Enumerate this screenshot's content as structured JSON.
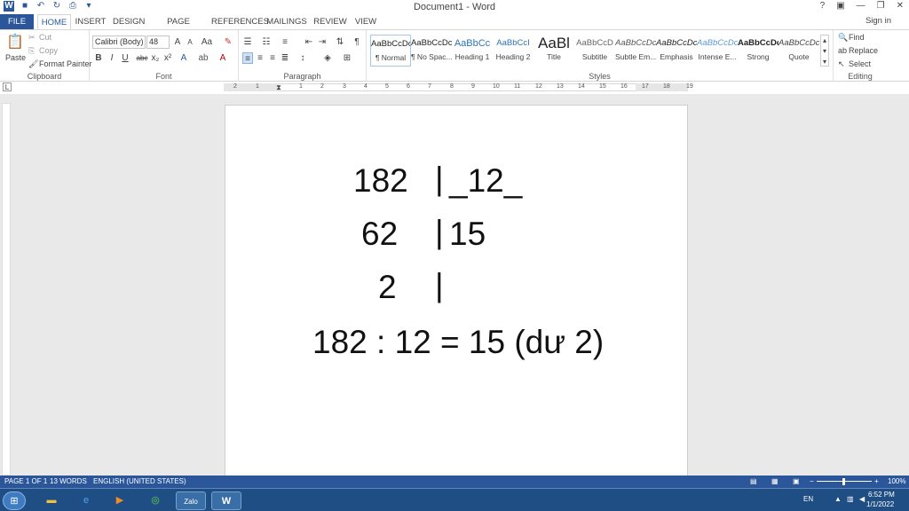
{
  "window": {
    "title": "Document1 - Word",
    "help": "?",
    "signin": "Sign in"
  },
  "tabs": [
    "FILE",
    "HOME",
    "INSERT",
    "DESIGN",
    "PAGE LAYOUT",
    "REFERENCES",
    "MAILINGS",
    "REVIEW",
    "VIEW"
  ],
  "clipboard": {
    "paste": "Paste",
    "cut": "Cut",
    "copy": "Copy",
    "format_painter": "Format Painter",
    "label": "Clipboard"
  },
  "font": {
    "name": "Calibri (Body)",
    "size": "48",
    "label": "Font"
  },
  "paragraph": {
    "label": "Paragraph"
  },
  "styles": {
    "label": "Styles",
    "items": [
      {
        "preview": "AaBbCcDc",
        "name": "¶ Normal"
      },
      {
        "preview": "AaBbCcDc",
        "name": "¶ No Spac..."
      },
      {
        "preview": "AaBbCc",
        "name": "Heading 1"
      },
      {
        "preview": "AaBbCcI",
        "name": "Heading 2"
      },
      {
        "preview": "AaBl",
        "name": "Title"
      },
      {
        "preview": "AaBbCcD",
        "name": "Subtitle"
      },
      {
        "preview": "AaBbCcDc",
        "name": "Subtle Em..."
      },
      {
        "preview": "AaBbCcDc",
        "name": "Emphasis"
      },
      {
        "preview": "AaBbCcDc",
        "name": "Intense E..."
      },
      {
        "preview": "AaBbCcDc",
        "name": "Strong"
      },
      {
        "preview": "AaBbCcDc",
        "name": "Quote"
      }
    ]
  },
  "editing": {
    "find": "Find",
    "replace": "Replace",
    "select": "Select",
    "label": "Editing"
  },
  "ruler": [
    "2",
    "1",
    "1",
    "1",
    "2",
    "3",
    "4",
    "5",
    "6",
    "7",
    "8",
    "9",
    "10",
    "11",
    "12",
    "13",
    "14",
    "15",
    "16",
    "17",
    "18",
    "19"
  ],
  "document": {
    "line1_dividend": "182",
    "line1_bar": "|",
    "line1_divisor": "_12_",
    "line2_rem": "62",
    "line2_bar": "|",
    "line2_quot": "15",
    "line3_rem": "2",
    "line3_bar": "|",
    "result": "182 : 12 = 15 (dư 2)"
  },
  "status": {
    "page": "PAGE 1 OF 1",
    "words": "13 WORDS",
    "language": "ENGLISH (UNITED STATES)",
    "zoom": "100%"
  },
  "taskbar": {
    "lang": "EN",
    "time": "6:52 PM",
    "date": "1/1/2022",
    "zalo": "Zalo"
  },
  "colors": {
    "accent": "#2b579a",
    "taskbar": "#1f4e84"
  }
}
